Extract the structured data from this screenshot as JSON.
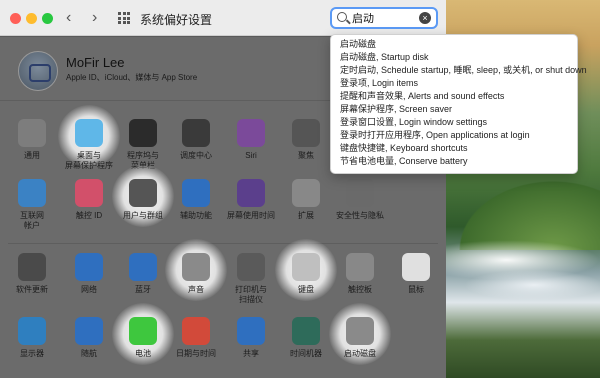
{
  "window": {
    "title": "系统偏好设置",
    "nav_back": "‹",
    "nav_forward": "›"
  },
  "search": {
    "value": "启动",
    "clear_label": "×"
  },
  "dropdown": [
    "启动磁盘",
    "启动磁盘, Startup disk",
    "定时启动, Schedule startup, 睡眠, sleep, 或关机, or shut down",
    "登录项, Login items",
    "提醒和声音效果, Alerts and sound effects",
    "屏幕保护程序, Screen saver",
    "登录窗口设置, Login window settings",
    "登录时打开应用程序, Open applications at login",
    "键盘快捷键, Keyboard shortcuts",
    "节省电池电量, Conserve battery"
  ],
  "profile": {
    "name": "MoFir Lee",
    "subtitle": "Apple ID、iCloud、媒体与 App Store"
  },
  "rows": [
    [
      {
        "label": "通用",
        "icon": "general-icon",
        "color": "#7d7d7d"
      },
      {
        "label": "桌面与\n屏幕保护程序",
        "icon": "desktop-screensaver-icon",
        "color": "#5fb7e8",
        "highlight": true
      },
      {
        "label": "程序坞与\n菜单栏",
        "icon": "dock-icon",
        "color": "#2b2b2b"
      },
      {
        "label": "调度中心",
        "icon": "mission-control-icon",
        "color": "#3a3a3a"
      },
      {
        "label": "Siri",
        "icon": "siri-icon",
        "color": "#7b4a9a"
      },
      {
        "label": "聚焦",
        "icon": "spotlight-icon",
        "color": "#555555"
      }
    ],
    [
      {
        "label": "互联网\n帐户",
        "icon": "internet-accounts-icon",
        "color": "#3b82c4"
      },
      {
        "label": "触控 ID",
        "icon": "touch-id-icon",
        "color": "#d2506a"
      },
      {
        "label": "用户与群组",
        "icon": "users-groups-icon",
        "color": "#555555",
        "highlight": true
      },
      {
        "label": "辅助功能",
        "icon": "accessibility-icon",
        "color": "#2f6fbf"
      },
      {
        "label": "屏幕使用时间",
        "icon": "screen-time-icon",
        "color": "#5b3f8c"
      },
      {
        "label": "扩展",
        "icon": "extensions-icon",
        "color": "#888888"
      },
      {
        "label": "安全性与隐私",
        "icon": "security-icon",
        "color": "#6a6a6a"
      }
    ],
    [
      {
        "label": "软件更新",
        "icon": "software-update-icon",
        "color": "#4a4a4a"
      },
      {
        "label": "网络",
        "icon": "network-icon",
        "color": "#2f6fbf"
      },
      {
        "label": "蓝牙",
        "icon": "bluetooth-icon",
        "color": "#2f6fbf"
      },
      {
        "label": "声音",
        "icon": "sound-icon",
        "color": "#8a8a8a",
        "highlight": true
      },
      {
        "label": "打印机与\n扫描仪",
        "icon": "printer-icon",
        "color": "#5a5a5a"
      },
      {
        "label": "键盘",
        "icon": "keyboard-icon",
        "color": "#bfbfbf",
        "highlight": true
      },
      {
        "label": "触控板",
        "icon": "trackpad-icon",
        "color": "#888888"
      },
      {
        "label": "鼠标",
        "icon": "mouse-icon",
        "color": "#e0e0e0"
      }
    ],
    [
      {
        "label": "显示器",
        "icon": "displays-icon",
        "color": "#2f7fbf"
      },
      {
        "label": "随航",
        "icon": "sidecar-icon",
        "color": "#2f6fbf"
      },
      {
        "label": "电池",
        "icon": "battery-icon",
        "color": "#3ec73e",
        "highlight": true
      },
      {
        "label": "日期与时间",
        "icon": "date-time-icon",
        "color": "#d24a3a"
      },
      {
        "label": "共享",
        "icon": "sharing-icon",
        "color": "#2f6fbf"
      },
      {
        "label": "时间机器",
        "icon": "time-machine-icon",
        "color": "#2e6b5a"
      },
      {
        "label": "启动磁盘",
        "icon": "startup-disk-icon",
        "color": "#8a8a8a",
        "highlight": true
      }
    ]
  ]
}
